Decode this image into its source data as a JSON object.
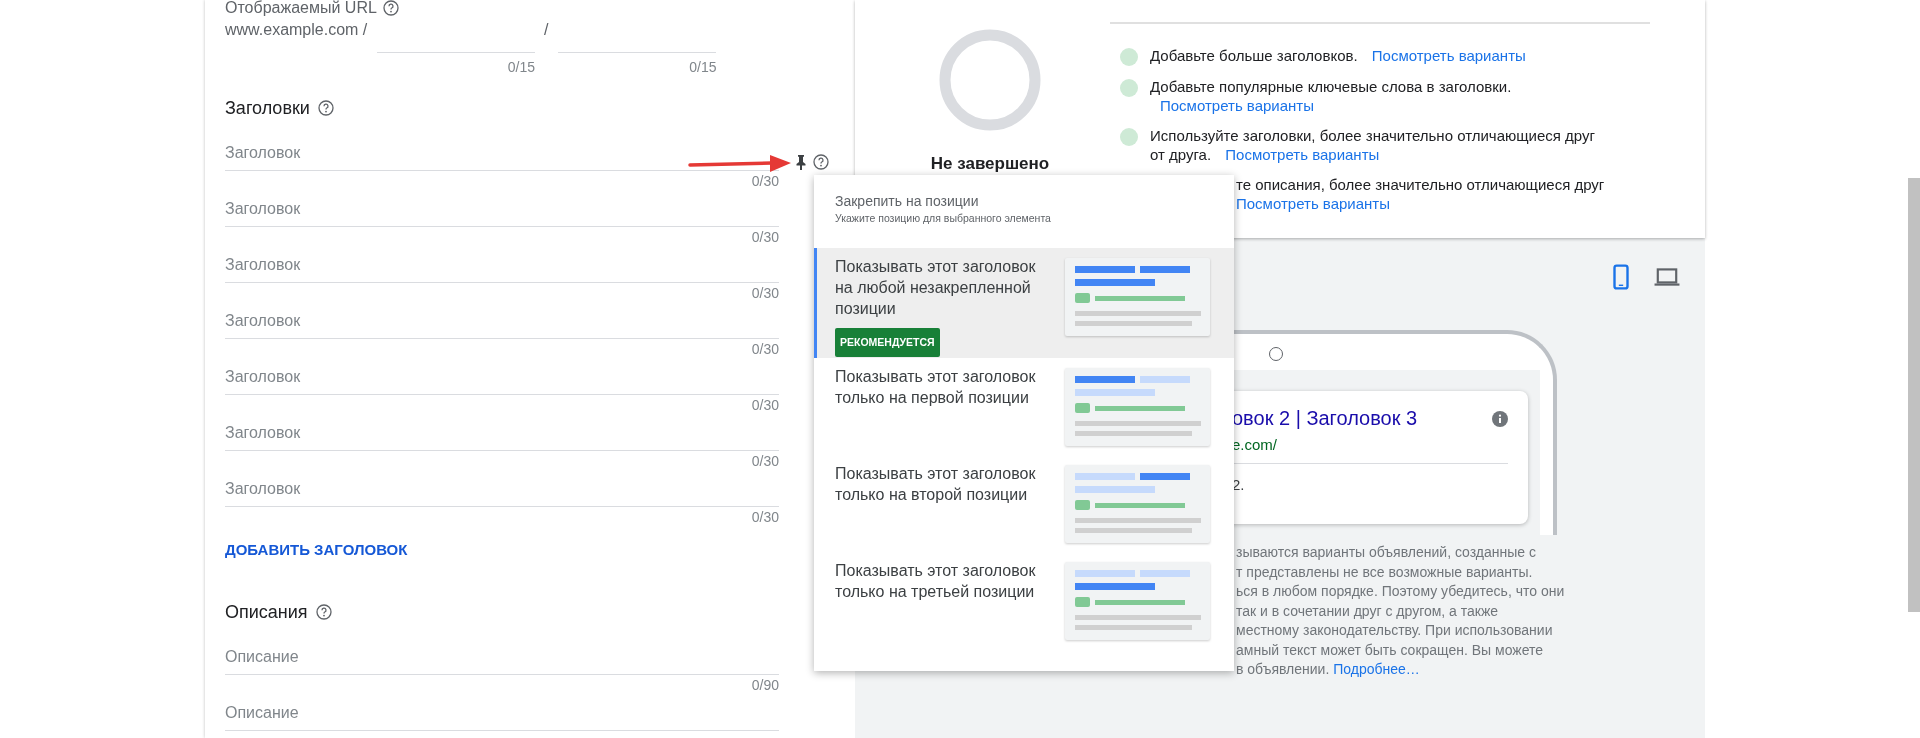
{
  "display_url": {
    "label": "Отображаемый URL",
    "domain": "www.example.com /",
    "separator": "/",
    "paths": [
      {
        "counter": "0/15"
      },
      {
        "counter": "0/15"
      }
    ]
  },
  "headlines": {
    "title": "Заголовки",
    "fields": [
      {
        "placeholder": "Заголовок",
        "counter": "0/30",
        "pin_controls": true
      },
      {
        "placeholder": "Заголовок",
        "counter": "0/30",
        "pin_controls": false
      },
      {
        "placeholder": "Заголовок",
        "counter": "0/30",
        "pin_controls": false
      },
      {
        "placeholder": "Заголовок",
        "counter": "0/30",
        "pin_controls": false
      },
      {
        "placeholder": "Заголовок",
        "counter": "0/30",
        "pin_controls": false
      },
      {
        "placeholder": "Заголовок",
        "counter": "0/30",
        "pin_controls": false
      },
      {
        "placeholder": "Заголовок",
        "counter": "0/30",
        "pin_controls": false
      }
    ],
    "add_link": "ДОБАВИТЬ ЗАГОЛОВОК"
  },
  "descriptions": {
    "title": "Описания",
    "fields": [
      {
        "placeholder": "Описание",
        "counter": "0/90"
      },
      {
        "placeholder": "Описание"
      }
    ]
  },
  "strength": {
    "status": "Не завершено",
    "tips": [
      {
        "text": "Добавьте больше заголовков.",
        "link": "Посмотреть варианты"
      },
      {
        "text": "Добавьте популярные ключевые слова в заголовки.",
        "link": "Посмотреть варианты"
      },
      {
        "text": "Используйте заголовки, более значительно отличающиеся друг от друга.",
        "link": "Посмотреть варианты"
      }
    ],
    "partial_tip": {
      "text": "те описания, более значительно отличающиеся друг",
      "link": "Посмотреть варианты"
    }
  },
  "preview": {
    "devices": [
      {
        "kind": "mobile",
        "selected": true
      },
      {
        "kind": "desktop",
        "selected": false
      }
    ],
    "ad": {
      "title": "овок 2 | Заголовок 3",
      "url": "e.com/",
      "description": "2."
    },
    "disclaimer_lines": [
      "зываются варианты объявлений, созданные с",
      "т представлены не все возможные варианты.",
      "ься в любом порядке. Поэтому убедитесь, что они",
      "так и в сочетании друг с другом, а также",
      "местному законодательству. При использовании",
      "амный текст может быть сокращен. Вы можете",
      "в объявлении."
    ],
    "more_link": "Подробнее…"
  },
  "pin_menu": {
    "title": "Закрепить на позиции",
    "subtitle": "Укажите позицию для выбранного элемента",
    "options": [
      {
        "text": "Показывать этот заголовок на любой незакрепленной позиции",
        "kind": "any",
        "selected": true,
        "badge": "РЕКОМЕНДУЕТСЯ"
      },
      {
        "text": "Показывать этот заголовок только на первой позиции",
        "kind": "first",
        "selected": false
      },
      {
        "text": "Показывать этот заголовок только на второй позиции",
        "kind": "second",
        "selected": false
      },
      {
        "text": "Показывать этот заголовок только на третьей позиции",
        "kind": "third",
        "selected": false
      }
    ]
  }
}
